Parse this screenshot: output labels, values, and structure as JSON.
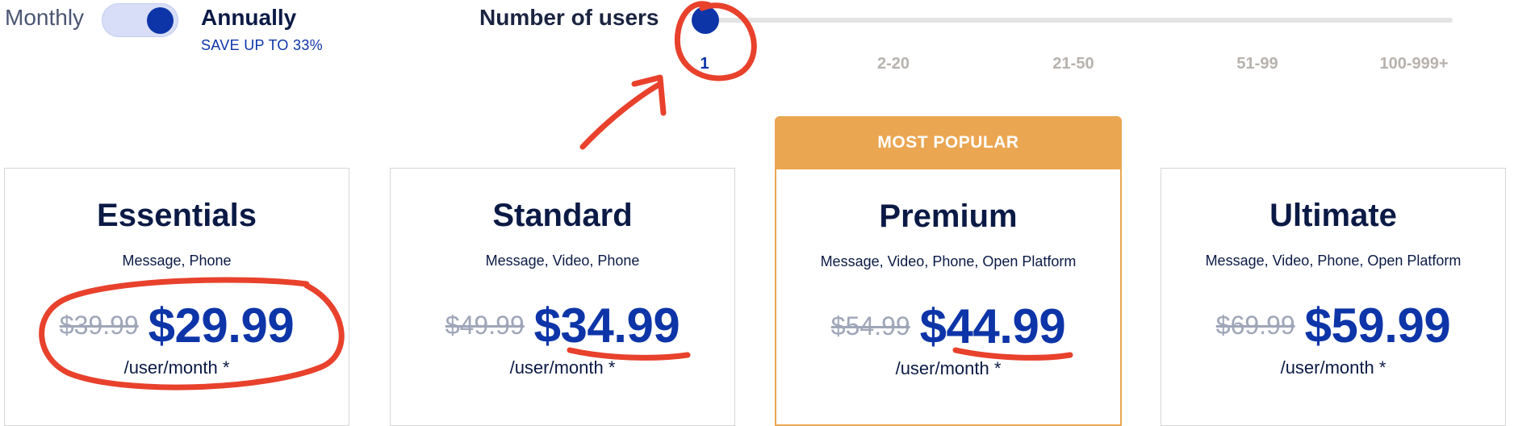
{
  "billing": {
    "monthly_label": "Monthly",
    "annually_label": "Annually",
    "save_note": "SAVE UP TO 33%",
    "selected": "Annually"
  },
  "users": {
    "title": "Number of users",
    "ticks": [
      "1",
      "2-20",
      "21-50",
      "51-99",
      "100-999+"
    ],
    "selected": "1"
  },
  "popular_badge": "MOST POPULAR",
  "plans": [
    {
      "name": "Essentials",
      "features": "Message, Phone",
      "old_price": "$39.99",
      "price": "$29.99",
      "per": "/user/month *"
    },
    {
      "name": "Standard",
      "features": "Message, Video, Phone",
      "old_price": "$49.99",
      "price": "$34.99",
      "per": "/user/month *"
    },
    {
      "name": "Premium",
      "features": "Message, Video, Phone, Open Platform",
      "old_price": "$54.99",
      "price": "$44.99",
      "per": "/user/month *"
    },
    {
      "name": "Ultimate",
      "features": "Message, Video, Phone, Open Platform",
      "old_price": "$69.99",
      "price": "$59.99",
      "per": "/user/month *"
    }
  ],
  "colors": {
    "accent": "#0d35a8",
    "popular": "#eba652",
    "annotation": "#e8412c"
  }
}
